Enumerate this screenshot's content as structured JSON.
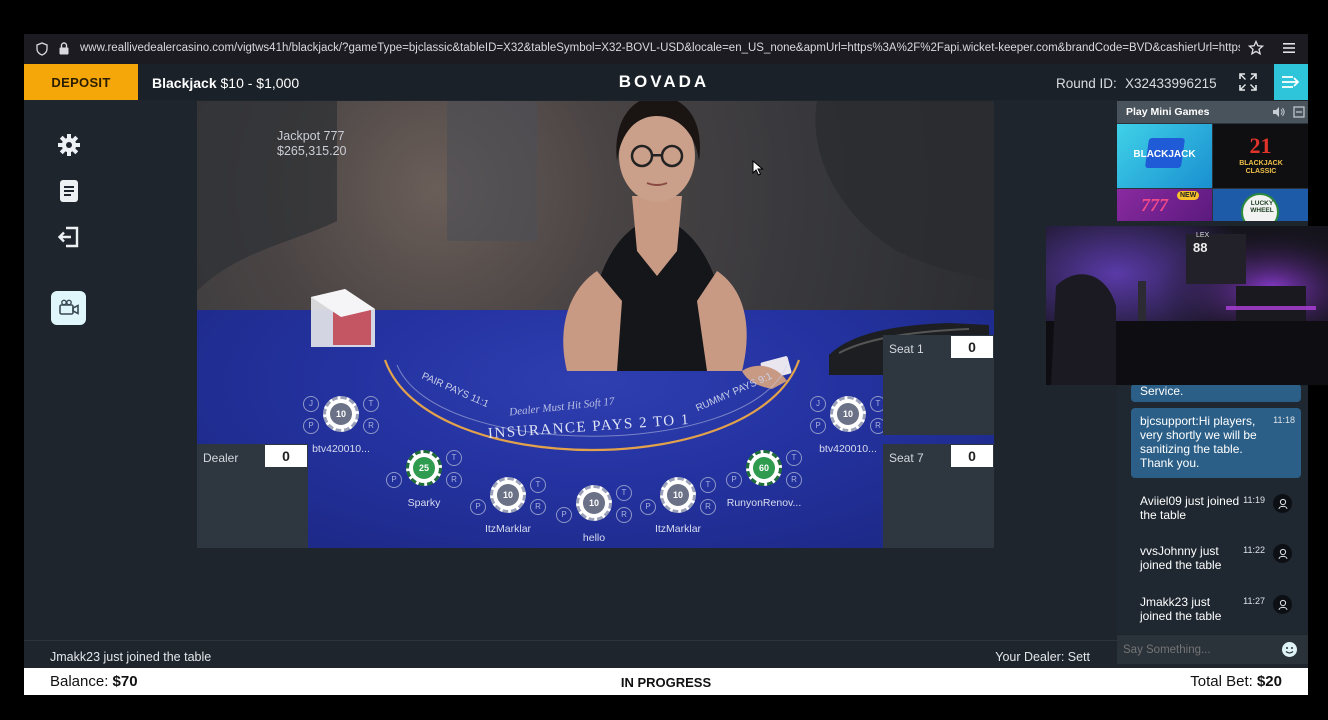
{
  "browser": {
    "url": "www.reallivedealercasino.com/vigtws41h/blackjack/?gameType=bjclassic&tableID=X32&tableSymbol=X32-BOVL-USD&locale=en_US_none&apmUrl=https%3A%2F%2Fapi.wicket-keeper.com&brandCode=BVD&cashierUrl=https%"
  },
  "topbar": {
    "deposit_label": "DEPOSIT",
    "table_name": "Blackjack",
    "table_limits": "$10 - $1,000",
    "brand": "BOVADA",
    "round_label": "Round ID:",
    "round_id": "X32433996215"
  },
  "video": {
    "jackpot_title": "Jackpot 777",
    "jackpot_amount": "$265,315.20",
    "felt_text_1": "INSURANCE PAYS 2 TO 1",
    "felt_text_2": "PAIR PAYS 11:1",
    "felt_text_3": "Dealer Must Hit Soft 17",
    "felt_text_4": "RUMMY PAYS 9:1"
  },
  "panels": {
    "seat1": {
      "label": "Seat 1",
      "value": "0"
    },
    "seat7": {
      "label": "Seat 7",
      "value": "0"
    },
    "dealer": {
      "label": "Dealer",
      "value": "0"
    }
  },
  "seats": [
    {
      "name": "btv420010...",
      "chip": "10"
    },
    {
      "name": "Sparky",
      "chip": "25"
    },
    {
      "name": "ItzMarklar",
      "chip": "10"
    },
    {
      "name": "hello",
      "chip": "10"
    },
    {
      "name": "ItzMarklar",
      "chip": "10"
    },
    {
      "name": "RunyonRenov...",
      "chip": "60"
    },
    {
      "name": "btv420010...",
      "chip": "10"
    }
  ],
  "side_letters": {
    "j": "J",
    "t": "T",
    "p": "P",
    "r": "R"
  },
  "mini_games": {
    "title": "Play Mini Games",
    "tiles": [
      {
        "label": "BLACKJACK"
      },
      {
        "label": "21",
        "sub": "BLACKJACK CLASSIC"
      },
      {
        "label": "777",
        "badge": "NEW"
      },
      {
        "label": "LUCKY WHEEL"
      }
    ]
  },
  "webcam": {
    "sign": "LEX",
    "number": "88"
  },
  "chat": {
    "messages": [
      {
        "text": "Service.",
        "time": ""
      },
      {
        "text": "bjcsupport:Hi players, very shortly we will be sanitizing the table. Thank you.",
        "time": "11:18"
      },
      {
        "text": "Aviiel09 just joined the table",
        "time": "11:19"
      },
      {
        "text": "vvsJohnny just joined the table",
        "time": "11:22"
      },
      {
        "text": "Jmakk23 just joined the table",
        "time": "11:27"
      }
    ],
    "placeholder": "Say Something..."
  },
  "status": {
    "join_message": "Jmakk23 just joined the table",
    "dealer_label": "Your Dealer: Sett"
  },
  "bottom": {
    "balance_label": "Balance:",
    "balance_value": "$70",
    "game_status": "IN PROGRESS",
    "total_bet_label": "Total Bet:",
    "total_bet_value": "$20"
  },
  "colors": {
    "deposit": "#f5a70a",
    "accent": "#2ec5db",
    "felt": "#2432a0",
    "chat_bubble": "#2b5f87"
  }
}
